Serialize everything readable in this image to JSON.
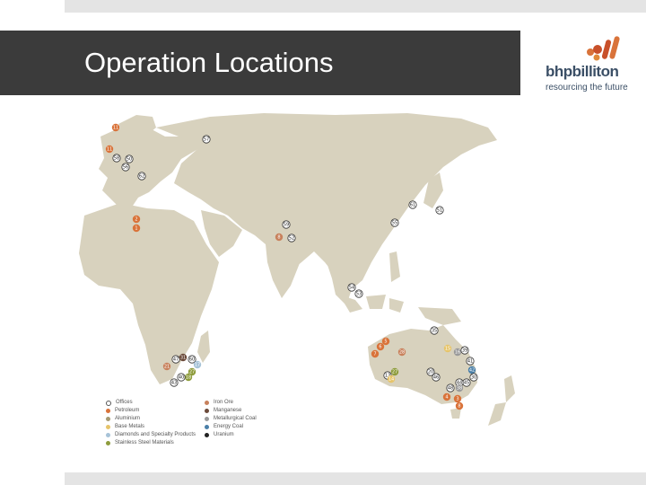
{
  "slide": {
    "title": "Operation Locations"
  },
  "logo": {
    "wordmark": "bhpbilliton",
    "tagline": "resourcing the future"
  },
  "legend": [
    {
      "label": "Offices",
      "color": "#ffffff",
      "hollow": true
    },
    {
      "label": "Petroleum",
      "color": "#d9733a"
    },
    {
      "label": "Aluminium",
      "color": "#a59a73"
    },
    {
      "label": "Base Metals",
      "color": "#e6c46a"
    },
    {
      "label": "Diamonds and Specialty Products",
      "color": "#a7c3d8"
    },
    {
      "label": "Stainless Steel Materials",
      "color": "#8e9c3c"
    },
    {
      "label": "Iron Ore",
      "color": "#c8815c"
    },
    {
      "label": "Manganese",
      "color": "#6b4a3a"
    },
    {
      "label": "Metallurgical Coal",
      "color": "#9a9a9a"
    },
    {
      "label": "Energy Coal",
      "color": "#4a7fa8"
    },
    {
      "label": "Uranium",
      "color": "#222222"
    }
  ],
  "markers": [
    {
      "label": "11",
      "type": "Petroleum"
    },
    {
      "label": "11",
      "type": "Petroleum"
    },
    {
      "label": "58",
      "type": "Offices"
    },
    {
      "label": "50",
      "type": "Offices"
    },
    {
      "label": "56",
      "type": "Offices"
    },
    {
      "label": "57",
      "type": "Offices"
    },
    {
      "label": "62",
      "type": "Offices"
    },
    {
      "label": "2",
      "type": "Petroleum"
    },
    {
      "label": "1",
      "type": "Petroleum"
    },
    {
      "label": "59",
      "type": "Offices"
    },
    {
      "label": "8",
      "type": "Iron Ore"
    },
    {
      "label": "52",
      "type": "Offices"
    },
    {
      "label": "61",
      "type": "Offices"
    },
    {
      "label": "51",
      "type": "Offices"
    },
    {
      "label": "55",
      "type": "Offices"
    },
    {
      "label": "54",
      "type": "Offices"
    },
    {
      "label": "53",
      "type": "Offices"
    },
    {
      "label": "47",
      "type": "Offices"
    },
    {
      "label": "31",
      "type": "Manganese"
    },
    {
      "label": "60",
      "type": "Offices"
    },
    {
      "label": "17",
      "type": "Diamonds and Specialty Products"
    },
    {
      "label": "27",
      "type": "Stainless Steel Materials"
    },
    {
      "label": "18",
      "type": "Stainless Steel Materials"
    },
    {
      "label": "40",
      "type": "Offices"
    },
    {
      "label": "43",
      "type": "Offices"
    },
    {
      "label": "21",
      "type": "Iron Ore"
    },
    {
      "label": "35",
      "type": "Offices"
    },
    {
      "label": "5",
      "type": "Petroleum"
    },
    {
      "label": "6",
      "type": "Petroleum"
    },
    {
      "label": "7",
      "type": "Petroleum"
    },
    {
      "label": "28",
      "type": "Iron Ore"
    },
    {
      "label": "15",
      "type": "Base Metals"
    },
    {
      "label": "16",
      "type": "Metallurgical Coal"
    },
    {
      "label": "39",
      "type": "Offices"
    },
    {
      "label": "41",
      "type": "Offices"
    },
    {
      "label": "42",
      "type": "Energy Coal"
    },
    {
      "label": "30",
      "type": "Offices"
    },
    {
      "label": "45",
      "type": "Offices"
    },
    {
      "label": "44",
      "type": "Offices"
    },
    {
      "label": "13",
      "type": "Offices"
    },
    {
      "label": "27",
      "type": "Stainless Steel Materials"
    },
    {
      "label": "14",
      "type": "Base Metals"
    },
    {
      "label": "20",
      "type": "Offices"
    },
    {
      "label": "46",
      "type": "Offices"
    },
    {
      "label": "48",
      "type": "Offices"
    },
    {
      "label": "38",
      "type": "Metallurgical Coal"
    },
    {
      "label": "4",
      "type": "Petroleum"
    },
    {
      "label": "3",
      "type": "Petroleum"
    },
    {
      "label": "8",
      "type": "Petroleum"
    }
  ]
}
